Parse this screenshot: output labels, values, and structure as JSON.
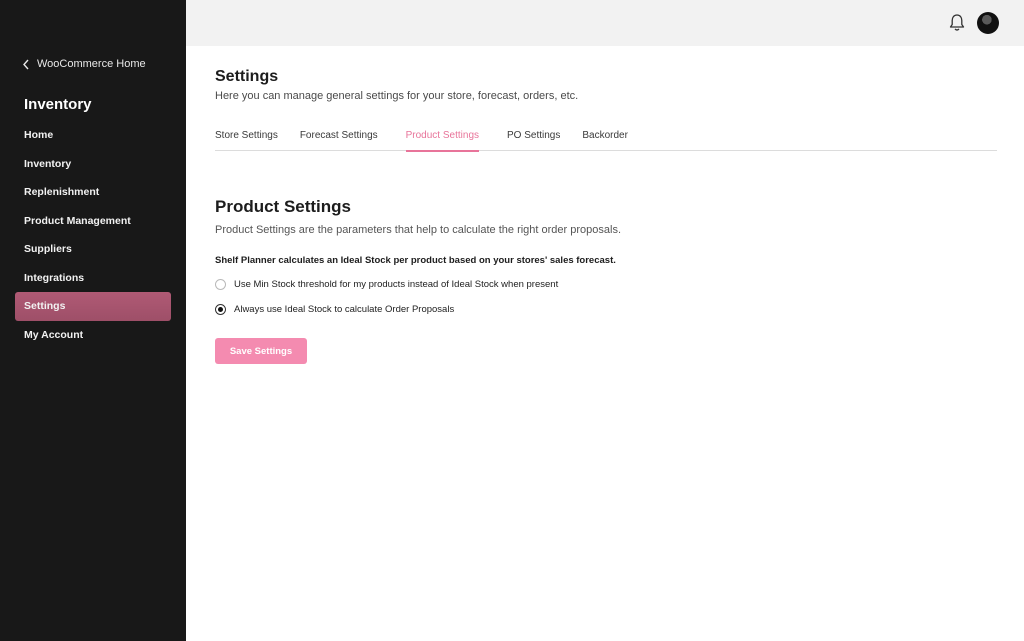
{
  "sidebar": {
    "back_label": "WooCommerce Home",
    "title": "Inventory",
    "items": [
      {
        "label": "Home"
      },
      {
        "label": "Inventory"
      },
      {
        "label": "Replenishment"
      },
      {
        "label": "Product Management"
      },
      {
        "label": "Suppliers"
      },
      {
        "label": "Integrations"
      },
      {
        "label": "Settings"
      },
      {
        "label": "My Account"
      }
    ],
    "active_item": "Settings"
  },
  "topbar": {
    "icons": [
      "bell-icon",
      "avatar"
    ]
  },
  "page": {
    "title": "Settings",
    "subtitle": "Here you can manage general settings for your store, forecast, orders, etc."
  },
  "tabs": [
    {
      "label": "Store Settings"
    },
    {
      "label": "Forecast Settings"
    },
    {
      "label": "Product Settings"
    },
    {
      "label": "PO Settings"
    },
    {
      "label": "Backorder"
    }
  ],
  "active_tab": "Product Settings",
  "section": {
    "title": "Product Settings",
    "description": "Product Settings are the parameters that help to calculate the right order proposals.",
    "note": "Shelf Planner calculates an Ideal Stock per product based on your stores' sales forecast.",
    "options": [
      {
        "label": "Use Min Stock threshold for my products instead of Ideal Stock when present",
        "checked": false
      },
      {
        "label": "Always use Ideal Stock to calculate Order Proposals",
        "checked": true
      }
    ],
    "save_label": "Save Settings"
  },
  "colors": {
    "sidebar_bg": "#181818",
    "active_item_bg": "#a8566f",
    "accent": "#e8749a",
    "button_bg": "#f48bb0",
    "topbar_bg": "#f2f2f2"
  }
}
